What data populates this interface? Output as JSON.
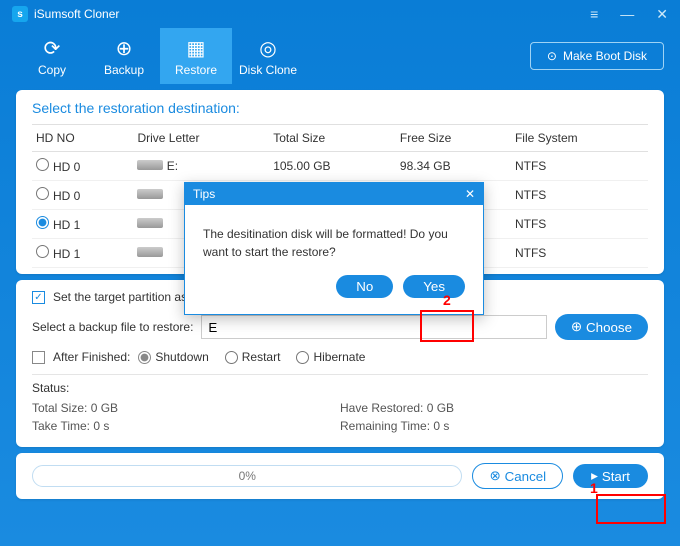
{
  "title": "iSumsoft Cloner",
  "toolbar": {
    "copy": "Copy",
    "backup": "Backup",
    "restore": "Restore",
    "diskclone": "Disk Clone",
    "makeboot": "Make Boot Disk"
  },
  "section": {
    "heading": "Select the restoration destination:"
  },
  "cols": {
    "hdno": "HD NO",
    "drive": "Drive Letter",
    "total": "Total Size",
    "free": "Free Size",
    "fs": "File System"
  },
  "rows": [
    {
      "hd": "HD 0",
      "drive": "E:",
      "total": "105.00 GB",
      "free": "98.34 GB",
      "fs": "NTFS",
      "sel": false
    },
    {
      "hd": "HD 0",
      "drive": "",
      "total": "",
      "free": "",
      "fs": "NTFS",
      "sel": false
    },
    {
      "hd": "HD 1",
      "drive": "",
      "total": "",
      "free": "",
      "fs": "NTFS",
      "sel": true
    },
    {
      "hd": "HD 1",
      "drive": "",
      "total": "",
      "free": "",
      "fs": "NTFS",
      "sel": false
    }
  ],
  "opt": {
    "setActive": "Set the target partition as the",
    "selectFile": "Select a backup file to restore:",
    "fileVal": "E",
    "choose": "Choose",
    "after": "After Finished:",
    "shutdown": "Shutdown",
    "restart": "Restart",
    "hibernate": "Hibernate"
  },
  "status": {
    "label": "Status:",
    "total": "Total Size: 0 GB",
    "have": "Have Restored: 0 GB",
    "take": "Take Time: 0 s",
    "remain": "Remaining Time: 0 s"
  },
  "footer": {
    "progress": "0%",
    "cancel": "Cancel",
    "start": "Start"
  },
  "dialog": {
    "title": "Tips",
    "msg": "The desitination disk will be formatted! Do you want to start the restore?",
    "no": "No",
    "yes": "Yes"
  },
  "ann": {
    "n1": "1",
    "n2": "2"
  }
}
